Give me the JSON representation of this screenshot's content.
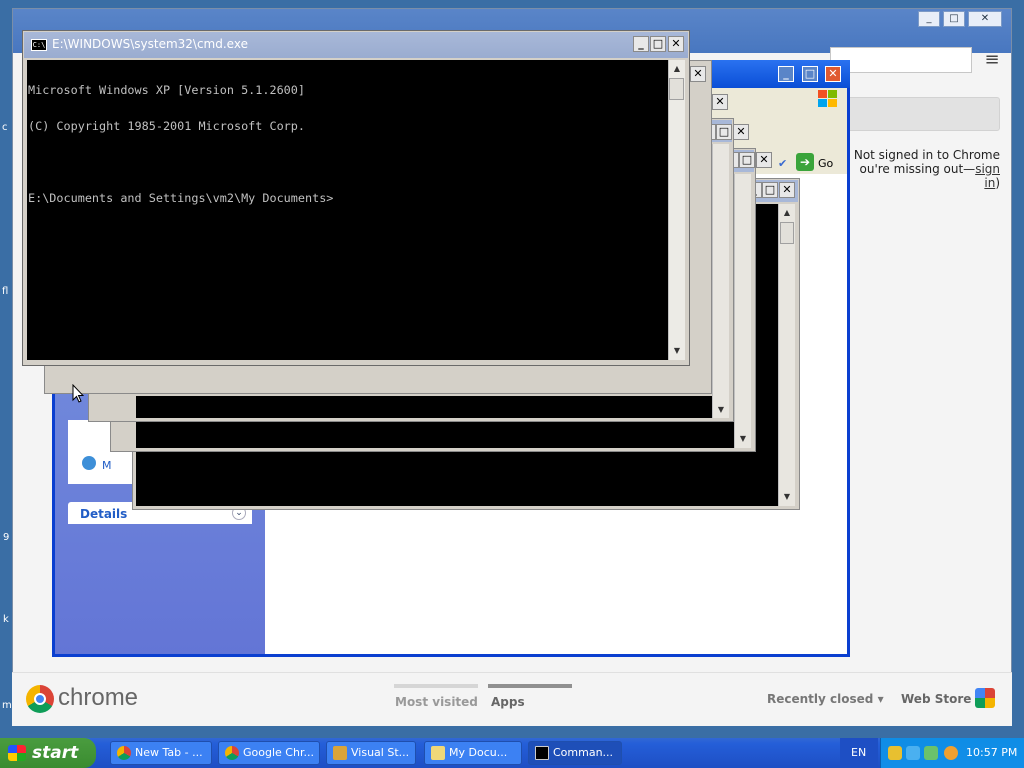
{
  "front_cmd": {
    "title": "E:\\WINDOWS\\system32\\cmd.exe",
    "icon_text": "C:\\",
    "lines": [
      "Microsoft Windows XP [Version 5.1.2600]",
      "(C) Copyright 1985-2001 Microsoft Corp.",
      "",
      "E:\\Documents and Settings\\vm2\\My Documents>"
    ]
  },
  "window_controls": {
    "minimize": "_",
    "maximize": "□",
    "close": "✕"
  },
  "scroll": {
    "up": "▲",
    "down": "▼"
  },
  "chrome": {
    "logo_text": "chrome",
    "not_signed_line1": "Not signed in to Chrome",
    "not_signed_line2_prefix": "ou're missing out—",
    "sign_in_link": "sign in",
    "sign_in_suffix": ")",
    "tabs": {
      "most_visited": "Most visited",
      "apps": "Apps"
    },
    "recently_closed": "Recently closed",
    "recently_closed_arrow": "▾",
    "web_store": "Web Store",
    "menu_icon": "≡",
    "left_edge_fragments": [
      "c",
      "fl",
      "9",
      "k",
      "m"
    ]
  },
  "explorer": {
    "go_label": "Go",
    "go_arrow": "➔",
    "task_item": "M",
    "details_label": "Details",
    "details_chevron": "⌄"
  },
  "taskbar": {
    "start": "start",
    "buttons": [
      {
        "label": "New Tab - ...",
        "icon": "chrome-icon"
      },
      {
        "label": "Google Chr...",
        "icon": "chrome-icon"
      },
      {
        "label": "Visual St...",
        "icon": "visual-studio-icon"
      },
      {
        "label": "My Docu...",
        "icon": "folder-icon"
      },
      {
        "label": "Comman...",
        "icon": "cmd-icon"
      }
    ],
    "language": "EN",
    "clock": "10:57 PM"
  }
}
